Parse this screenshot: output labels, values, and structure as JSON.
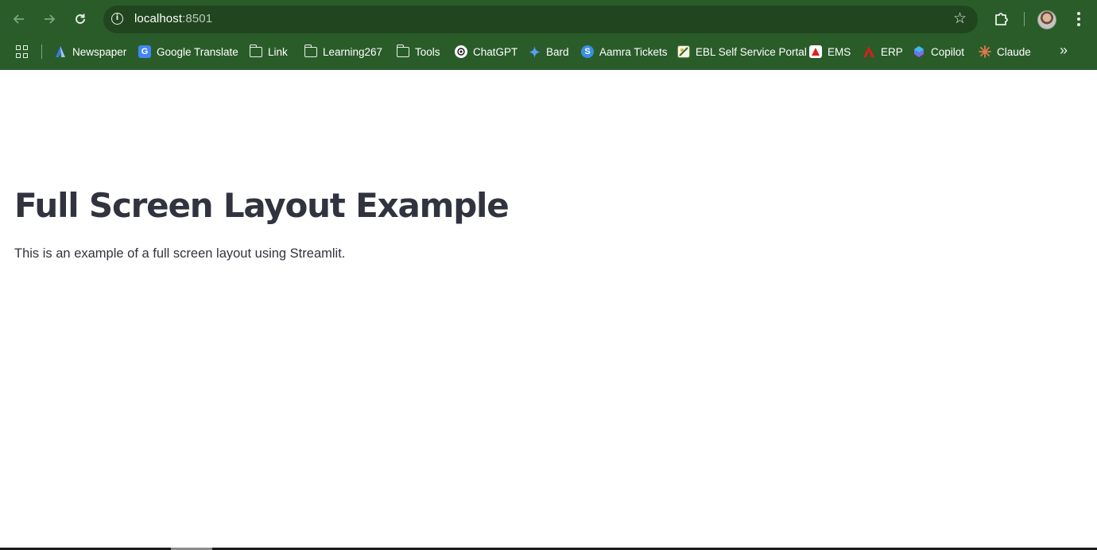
{
  "browser": {
    "url_host": "localhost",
    "url_port": ":8501",
    "icons": {
      "back": "back-arrow-icon",
      "forward": "forward-arrow-icon",
      "reload": "reload-icon",
      "site_info": "info-icon",
      "bookmark": "star-icon",
      "extensions": "puzzle-icon",
      "menu": "kebab-menu-icon"
    },
    "colors": {
      "frame": "#2a5c2a",
      "omnibox": "#21461f"
    }
  },
  "bookmarks": {
    "items": [
      {
        "label": "Newspaper",
        "icon": "newspaper-icon"
      },
      {
        "label": "Google Translate",
        "icon": "google-translate-icon"
      },
      {
        "label": "Link",
        "icon": "folder-icon"
      },
      {
        "label": "Learning267",
        "icon": "folder-icon"
      },
      {
        "label": "Tools",
        "icon": "folder-icon"
      },
      {
        "label": "ChatGPT",
        "icon": "chatgpt-icon"
      },
      {
        "label": "Bard",
        "icon": "bard-sparkle-icon"
      },
      {
        "label": "Aamra Tickets",
        "icon": "aamra-icon"
      },
      {
        "label": "EBL Self Service Portal",
        "icon": "ebl-icon"
      },
      {
        "label": "EMS",
        "icon": "ems-icon"
      },
      {
        "label": "ERP",
        "icon": "erp-icon"
      },
      {
        "label": "Copilot",
        "icon": "copilot-icon"
      },
      {
        "label": "Claude",
        "icon": "claude-icon"
      }
    ],
    "overflow_icon": "double-chevron-right-icon"
  },
  "page": {
    "title": "Full Screen Layout Example",
    "text": "This is an example of a full screen layout using Streamlit.",
    "text_color": "#31333f"
  }
}
